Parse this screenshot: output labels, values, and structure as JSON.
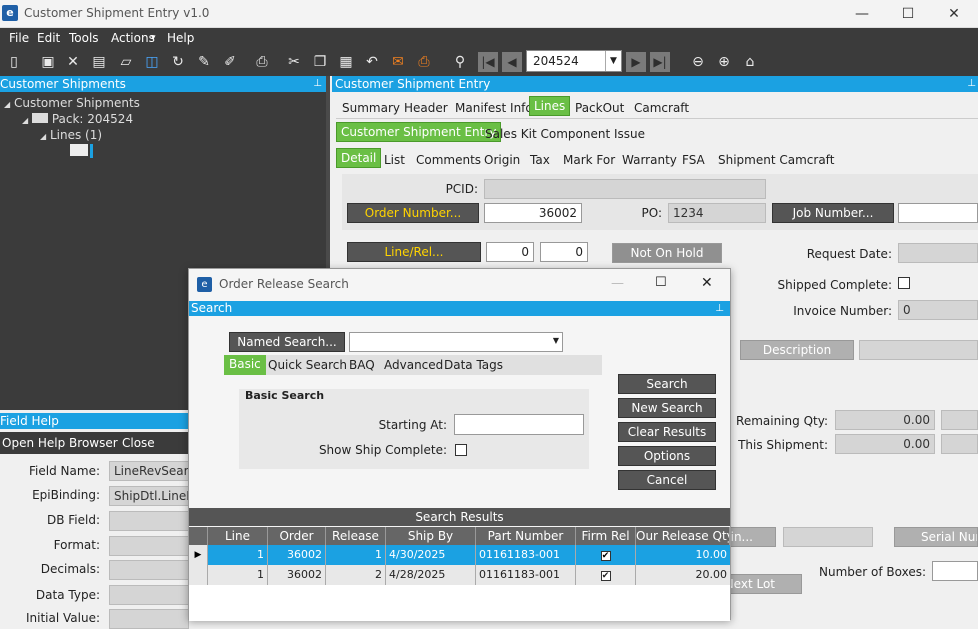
{
  "app": {
    "title": "Customer Shipment Entry v1.0",
    "logo": "e"
  },
  "menu": [
    "File",
    "Edit",
    "Tools",
    "Actions",
    "Help"
  ],
  "menu_actions_arrow": "▾",
  "toolbar": {
    "record_value": "204524"
  },
  "left_panel": {
    "header": "Customer Shipments",
    "tree_root": "Customer Shipments",
    "pack": "Pack: 204524",
    "lines": "Lines (1)"
  },
  "field_help": {
    "header": "Field Help",
    "open_help": "Open Help Browser",
    "close": "Close",
    "labels": [
      "Field Name:",
      "EpiBinding:",
      "DB Field:",
      "Format:",
      "Decimals:",
      "Data Type:",
      "Initial Value:"
    ],
    "field_name_value": "LineRevSearch",
    "epibinding_value": "ShipDtl.LineRe"
  },
  "main": {
    "header": "Customer Shipment Entry",
    "tabs_top": [
      "Summary",
      "Header",
      "Manifest Info",
      "Lines",
      "PackOut",
      "Camcraft"
    ],
    "tabs_second": [
      "Customer Shipment Entry",
      "Sales Kit Component Issue"
    ],
    "tabs_third": [
      "Detail",
      "List",
      "Comments",
      "Origin",
      "Tax",
      "Mark For",
      "Warranty",
      "FSA",
      "Shipment Camcraft"
    ],
    "pcid_label": "PCID:",
    "order_number_btn": "Order Number...",
    "order_value": "36002",
    "po_label": "PO:",
    "po_value": "1234",
    "job_number_btn": "Job Number...",
    "line_rel_btn": "Line/Rel...",
    "line_value": "0",
    "rel_value": "0",
    "hold_status": "Not On Hold",
    "request_date_label": "Request Date:",
    "shipped_complete_label": "Shipped Complete:",
    "invoice_number_label": "Invoice Number:",
    "invoice_value": "0",
    "description_btn": "Description",
    "remaining_qty_label": "Remaining Qty:",
    "remaining_qty": "0.00",
    "this_shipment_label": "This Shipment:",
    "this_shipment": "0.00",
    "bin_btn": "Bin...",
    "serial_btn": "Serial Num",
    "next_lot_btn": "Next Lot",
    "boxes_label": "Number of Boxes:"
  },
  "dialog": {
    "title": "Order Release Search",
    "header": "Search",
    "named_search_btn": "Named Search...",
    "tabs": [
      "Basic",
      "Quick Search",
      "BAQ",
      "Advanced",
      "Data Tags"
    ],
    "group_title": "Basic Search",
    "starting_at_label": "Starting At:",
    "show_ship_label": "Show Ship Complete:",
    "buttons": [
      "Search",
      "New Search",
      "Clear Results",
      "Options",
      "Cancel"
    ],
    "results_header": "Search Results",
    "columns": [
      "Line",
      "Order",
      "Release",
      "Ship By",
      "Part Number",
      "Firm Rel",
      "Our Release Qty"
    ],
    "rows": [
      {
        "line": "1",
        "order": "36002",
        "release": "1",
        "ship_by": "4/30/2025",
        "part": "01161183-001",
        "firm": true,
        "qty": "10.00"
      },
      {
        "line": "1",
        "order": "36002",
        "release": "2",
        "ship_by": "4/28/2025",
        "part": "01161183-001",
        "firm": true,
        "qty": "20.00"
      }
    ]
  },
  "colors": {
    "accent_blue": "#1ba1e2",
    "tab_green": "#6abf45",
    "dark_bg": "#3b3b3b",
    "selected_row": "#1ba1e2"
  }
}
